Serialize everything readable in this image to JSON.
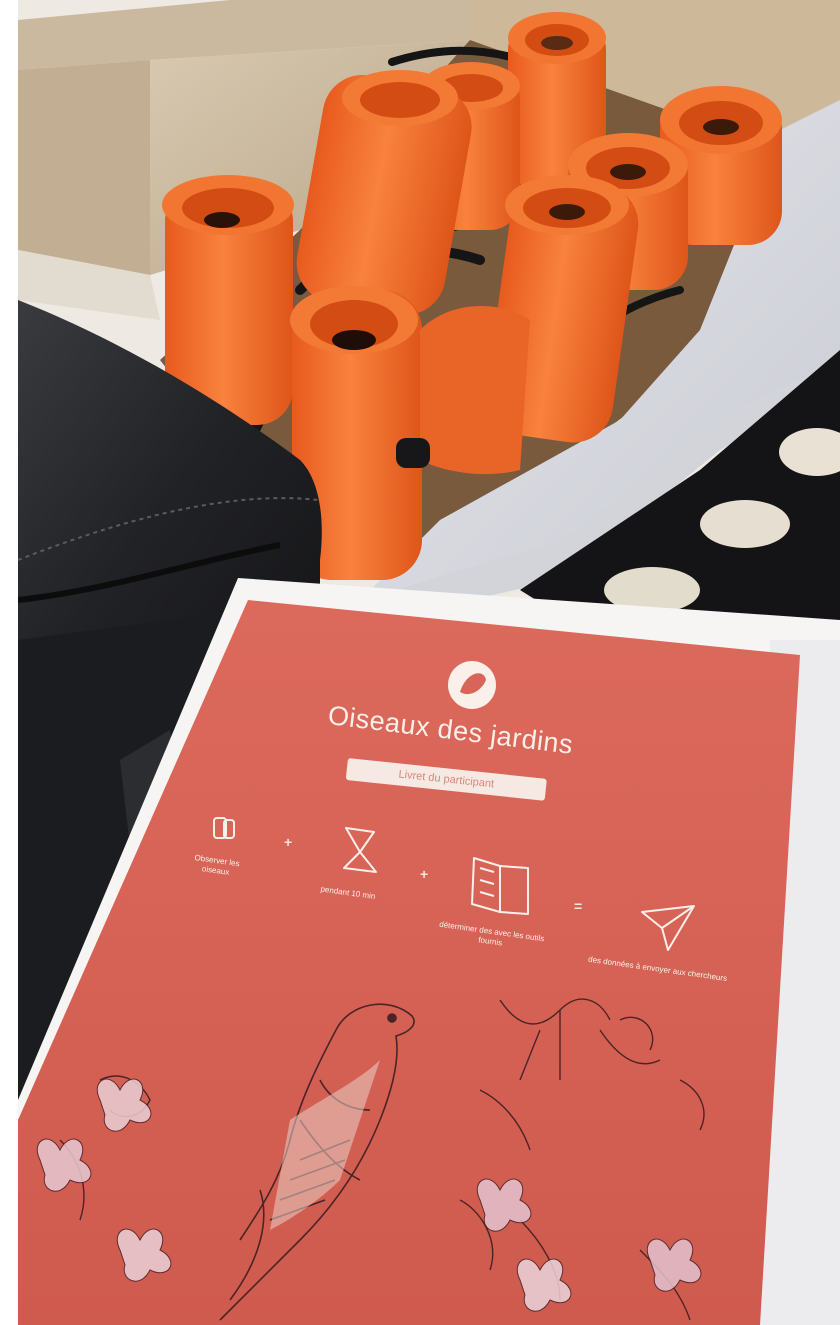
{
  "booklet": {
    "title": "Oiseaux des jardins",
    "subtitle": "Livret du participant",
    "steps": [
      {
        "label": "Observer les oiseaux",
        "icon": "binoculars-icon"
      },
      {
        "label": "pendant 10 min",
        "icon": "hourglass-icon"
      },
      {
        "label": "déterminer des avec les outils fournis",
        "icon": "open-book-icon"
      },
      {
        "label": "des données à envoyer aux chercheurs",
        "icon": "paper-plane-icon"
      }
    ],
    "operators": [
      "+",
      "+",
      "="
    ],
    "logo_icon": "bird-logo-icon"
  },
  "colors": {
    "binocular_orange": "#f36b2a",
    "booklet_red": "#d9655a",
    "case_black": "#232427",
    "foam_black": "#121214",
    "cardboard": "#c9b79f"
  }
}
